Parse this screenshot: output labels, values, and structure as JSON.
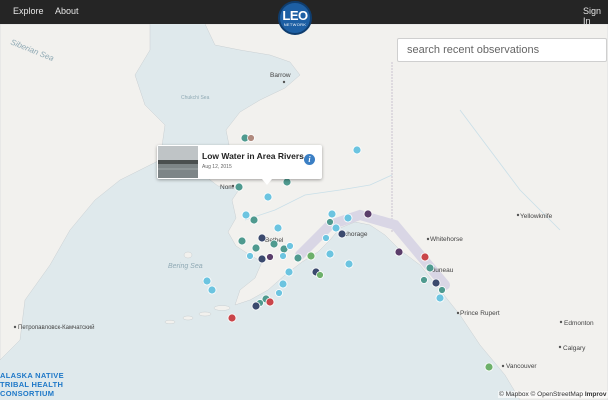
{
  "nav": {
    "explore_label": "Explore",
    "about_label": "About",
    "signin_label": "Sign In"
  },
  "logo": {
    "main": "LEO",
    "sub": "NETWORK",
    "color": "#1d5fa4"
  },
  "search": {
    "placeholder": "search recent observations"
  },
  "popup": {
    "title": "Low Water in Area Rivers",
    "date": "Aug 12, 2015",
    "info_icon": "info-icon"
  },
  "map_labels": {
    "siberian_sea": "Siberian Sea",
    "barrow": "Barrow",
    "chukchi_sea": "Chukchi Sea",
    "nome": "Nom",
    "bethel": "Bethel",
    "anchorage": "chorage",
    "bering_sea": "Bering Sea",
    "petropavlovsk": "Петропавловск-Камчатский",
    "yellowknife": "Yellowknife",
    "whitehorse": "Whitehorse",
    "juneau": "Juneau",
    "prince_rupert": "Prince Rupert",
    "edmonton": "Edmonton",
    "calgary": "Calgary",
    "vancouver": "Vancouver"
  },
  "partner": {
    "line1": "ALASKA NATIVE",
    "line2": "TRIBAL HEALTH",
    "line3": "CONSORTIUM"
  },
  "attribution": {
    "mapbox": "© Mapbox",
    "osm": "© OpenStreetMap",
    "improve": "Improv"
  },
  "colors": {
    "topbar": "#252525",
    "ocean": "#dfe9ec",
    "land": "#f2f1ee",
    "marker_teal": "#4f9a8f",
    "marker_lightblue": "#6cc4e0",
    "marker_navy": "#3b4a6e",
    "marker_red": "#c9454a",
    "marker_purple": "#5a3d6a",
    "marker_green": "#6db06a"
  }
}
